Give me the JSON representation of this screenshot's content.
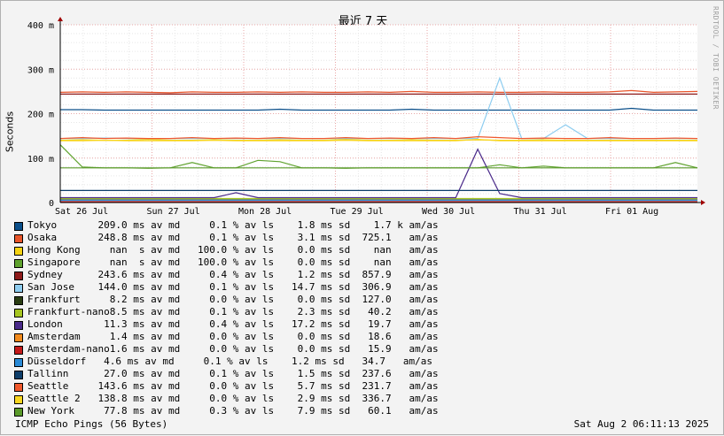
{
  "watermark": "RRDTOOL / TOBI OETIKER",
  "chart_data": {
    "type": "line",
    "title": "最近 7 天",
    "ylabel": "Seconds",
    "ylim": [
      0,
      0.4
    ],
    "y_ticks": [
      {
        "value": 0,
        "label": "0"
      },
      {
        "value": 0.1,
        "label": "100 m"
      },
      {
        "value": 0.2,
        "label": "200 m"
      },
      {
        "value": 0.3,
        "label": "300 m"
      },
      {
        "value": 0.4,
        "label": "400 m"
      }
    ],
    "x_ticks": [
      "Sat 26 Jul",
      "Sun 27 Jul",
      "Mon 28 Jul",
      "Tue 29 Jul",
      "Wed 30 Jul",
      "Thu 31 Jul",
      "Fri 01 Aug"
    ],
    "grid": true,
    "series": [
      {
        "name": "Tokyo",
        "color": "#0b4f8a",
        "values": [
          0.209,
          0.209,
          0.208,
          0.208,
          0.208,
          0.208,
          0.208,
          0.208,
          0.208,
          0.208,
          0.21,
          0.208,
          0.208,
          0.208,
          0.208,
          0.208,
          0.21,
          0.208,
          0.208,
          0.208,
          0.208,
          0.208,
          0.208,
          0.208,
          0.208,
          0.208,
          0.212,
          0.208,
          0.208,
          0.208
        ]
      },
      {
        "name": "Osaka",
        "color": "#e8552a",
        "values": [
          0.248,
          0.249,
          0.248,
          0.249,
          0.248,
          0.247,
          0.249,
          0.248,
          0.248,
          0.249,
          0.248,
          0.249,
          0.248,
          0.248,
          0.249,
          0.248,
          0.25,
          0.248,
          0.248,
          0.249,
          0.248,
          0.248,
          0.249,
          0.248,
          0.248,
          0.249,
          0.252,
          0.248,
          0.249,
          0.25
        ]
      },
      {
        "name": "Hong Kong",
        "color": "#f5d312",
        "values": [
          0.14,
          0.141,
          0.14,
          0.14,
          0.142,
          0.14,
          0.14,
          0.141,
          0.14,
          0.14,
          0.141,
          0.14,
          0.14,
          0.142,
          0.14,
          0.14,
          0.141,
          0.14,
          0.14,
          0.141,
          0.14,
          0.14,
          0.141,
          0.14,
          0.14,
          0.14,
          0.14,
          0.14,
          0.14,
          0.14
        ]
      },
      {
        "name": "Singapore",
        "color": "#5fa22e",
        "values": [
          0.13,
          0.08,
          0.078,
          0.078,
          0.077,
          0.078,
          0.09,
          0.078,
          0.078,
          0.095,
          0.092,
          0.078,
          0.078,
          0.077,
          0.078,
          0.078,
          0.078,
          0.078,
          0.078,
          0.078,
          0.085,
          0.078,
          0.082,
          0.078,
          0.078,
          0.078,
          0.078,
          0.078,
          0.09,
          0.078
        ]
      },
      {
        "name": "Sydney",
        "color": "#8e1a1a",
        "values": [
          0.244,
          0.244,
          0.244,
          0.244,
          0.244,
          0.244,
          0.244,
          0.244,
          0.244,
          0.244,
          0.244,
          0.244,
          0.244,
          0.244,
          0.244,
          0.244,
          0.244,
          0.244,
          0.244,
          0.244,
          0.244,
          0.244,
          0.244,
          0.244,
          0.244,
          0.244,
          0.244,
          0.244,
          0.244,
          0.244
        ]
      },
      {
        "name": "San Jose",
        "color": "#8ecdf0",
        "values": [
          0.144,
          0.144,
          0.145,
          0.144,
          0.144,
          0.144,
          0.144,
          0.144,
          0.144,
          0.144,
          0.144,
          0.144,
          0.144,
          0.144,
          0.144,
          0.144,
          0.144,
          0.144,
          0.144,
          0.144,
          0.28,
          0.144,
          0.144,
          0.175,
          0.144,
          0.144,
          0.144,
          0.144,
          0.144,
          0.144
        ]
      },
      {
        "name": "Frankfurt",
        "color": "#2a3d12",
        "values": [
          0.008,
          0.008,
          0.008,
          0.008,
          0.008,
          0.008,
          0.008,
          0.008,
          0.008,
          0.008,
          0.008,
          0.008,
          0.008,
          0.008,
          0.008,
          0.008,
          0.008,
          0.008,
          0.008,
          0.008,
          0.008,
          0.008,
          0.008,
          0.008,
          0.008,
          0.008,
          0.008,
          0.008,
          0.008,
          0.008
        ]
      },
      {
        "name": "Frankfurt-nano",
        "color": "#a6c520",
        "values": [
          0.009,
          0.009,
          0.009,
          0.009,
          0.009,
          0.009,
          0.009,
          0.009,
          0.009,
          0.009,
          0.009,
          0.009,
          0.009,
          0.009,
          0.009,
          0.009,
          0.009,
          0.009,
          0.009,
          0.009,
          0.009,
          0.009,
          0.009,
          0.009,
          0.009,
          0.009,
          0.009,
          0.009,
          0.009,
          0.009
        ]
      },
      {
        "name": "London",
        "color": "#4a2a8a",
        "values": [
          0.011,
          0.011,
          0.011,
          0.011,
          0.011,
          0.011,
          0.011,
          0.011,
          0.022,
          0.011,
          0.011,
          0.011,
          0.011,
          0.011,
          0.011,
          0.011,
          0.011,
          0.011,
          0.011,
          0.12,
          0.02,
          0.011,
          0.011,
          0.011,
          0.011,
          0.011,
          0.011,
          0.011,
          0.011,
          0.011
        ]
      },
      {
        "name": "Amsterdam",
        "color": "#f28a1c",
        "values": [
          0.001,
          0.001,
          0.001,
          0.001,
          0.001,
          0.001,
          0.001,
          0.001,
          0.001,
          0.001,
          0.001,
          0.001,
          0.001,
          0.001,
          0.001,
          0.001,
          0.001,
          0.001,
          0.001,
          0.001,
          0.001,
          0.001,
          0.001,
          0.001,
          0.001,
          0.001,
          0.001,
          0.001,
          0.001,
          0.001
        ]
      },
      {
        "name": "Amsterdam-nano",
        "color": "#c41a1a",
        "values": [
          0.002,
          0.002,
          0.002,
          0.002,
          0.002,
          0.002,
          0.002,
          0.002,
          0.002,
          0.002,
          0.002,
          0.002,
          0.002,
          0.002,
          0.002,
          0.002,
          0.002,
          0.002,
          0.002,
          0.002,
          0.002,
          0.002,
          0.002,
          0.002,
          0.002,
          0.002,
          0.002,
          0.002,
          0.002,
          0.002
        ]
      },
      {
        "name": "Düsseldorf",
        "color": "#2a8ad6",
        "values": [
          0.005,
          0.005,
          0.005,
          0.005,
          0.005,
          0.005,
          0.005,
          0.005,
          0.005,
          0.005,
          0.005,
          0.005,
          0.005,
          0.005,
          0.005,
          0.005,
          0.005,
          0.005,
          0.005,
          0.005,
          0.005,
          0.005,
          0.005,
          0.005,
          0.005,
          0.005,
          0.005,
          0.005,
          0.005,
          0.005
        ]
      },
      {
        "name": "Tallinn",
        "color": "#0e3e6a",
        "values": [
          0.027,
          0.027,
          0.027,
          0.027,
          0.027,
          0.027,
          0.027,
          0.027,
          0.027,
          0.027,
          0.027,
          0.027,
          0.027,
          0.027,
          0.027,
          0.027,
          0.027,
          0.027,
          0.027,
          0.027,
          0.027,
          0.027,
          0.027,
          0.027,
          0.027,
          0.027,
          0.027,
          0.027,
          0.027,
          0.027
        ]
      },
      {
        "name": "Seattle",
        "color": "#f0582c",
        "values": [
          0.144,
          0.146,
          0.144,
          0.145,
          0.144,
          0.144,
          0.146,
          0.144,
          0.145,
          0.144,
          0.146,
          0.144,
          0.144,
          0.146,
          0.144,
          0.145,
          0.144,
          0.146,
          0.144,
          0.148,
          0.146,
          0.144,
          0.145,
          0.144,
          0.144,
          0.146,
          0.144,
          0.144,
          0.145,
          0.144
        ]
      },
      {
        "name": "Seattle 2",
        "color": "#f8d620",
        "values": [
          0.139,
          0.139,
          0.14,
          0.139,
          0.139,
          0.139,
          0.139,
          0.14,
          0.139,
          0.139,
          0.139,
          0.139,
          0.139,
          0.14,
          0.139,
          0.139,
          0.139,
          0.139,
          0.139,
          0.142,
          0.139,
          0.139,
          0.139,
          0.139,
          0.139,
          0.139,
          0.139,
          0.139,
          0.139,
          0.139
        ]
      },
      {
        "name": "New York",
        "color": "#5a9a2a",
        "values": [
          0.078,
          0.078,
          0.078,
          0.078,
          0.078,
          0.078,
          0.078,
          0.078,
          0.078,
          0.078,
          0.078,
          0.078,
          0.078,
          0.078,
          0.078,
          0.078,
          0.078,
          0.078,
          0.078,
          0.078,
          0.078,
          0.078,
          0.078,
          0.078,
          0.078,
          0.078,
          0.078,
          0.078,
          0.078,
          0.078
        ]
      }
    ]
  },
  "legend": [
    {
      "name": "Tokyo",
      "color": "#0b4f8a",
      "stats": "            209.0 ms av md     0.1 % av ls    1.8 ms sd    1.7 k am/as"
    },
    {
      "name": "Osaka",
      "color": "#e8552a",
      "stats": "            248.8 ms av md     0.1 % av ls    3.1 ms sd  725.1   am/as"
    },
    {
      "name": "Hong Kong",
      "color": "#f5d312",
      "stats": "              nan  s av md   100.0 % av ls    0.0 ms sd    nan   am/as"
    },
    {
      "name": "Singapore",
      "color": "#5fa22e",
      "stats": "              nan  s av md   100.0 % av ls    0.0 ms sd    nan   am/as"
    },
    {
      "name": "Sydney",
      "color": "#8e1a1a",
      "stats": "            243.6 ms av md     0.4 % av ls    1.2 ms sd  857.9   am/as"
    },
    {
      "name": "San Jose",
      "color": "#8ecdf0",
      "stats": "            144.0 ms av md     0.1 % av ls   14.7 ms sd  306.9   am/as"
    },
    {
      "name": "Frankfurt",
      "color": "#2a3d12",
      "stats": "              8.2 ms av md     0.0 % av ls    0.0 ms sd  127.0   am/as"
    },
    {
      "name": "Frankfurt-nano",
      "color": "#a6c520",
      "stats": "              8.5 ms av md     0.1 % av ls    2.3 ms sd   40.2   am/as"
    },
    {
      "name": "London",
      "color": "#4a2a8a",
      "stats": "             11.3 ms av md     0.4 % av ls   17.2 ms sd   19.7   am/as"
    },
    {
      "name": "Amsterdam",
      "color": "#f28a1c",
      "stats": "              1.4 ms av md     0.0 % av ls    0.0 ms sd   18.6   am/as"
    },
    {
      "name": "Amsterdam-nano",
      "color": "#c41a1a",
      "stats": "              1.6 ms av md     0.0 % av ls    0.0 ms sd   15.9   am/as"
    },
    {
      "name": "Düsseldorf",
      "color": "#2a8ad6",
      "stats": "             4.6 ms av md     0.1 % av ls    1.2 ms sd   34.7   am/as"
    },
    {
      "name": "Tallinn",
      "color": "#0e3e6a",
      "stats": "             27.0 ms av md     0.1 % av ls    1.5 ms sd  237.6   am/as"
    },
    {
      "name": "Seattle",
      "color": "#f0582c",
      "stats": "            143.6 ms av md     0.0 % av ls    5.7 ms sd  231.7   am/as"
    },
    {
      "name": "Seattle 2",
      "color": "#f8d620",
      "stats": "            138.8 ms av md     0.0 % av ls    2.9 ms sd  336.7   am/as"
    },
    {
      "name": "New York",
      "color": "#5a9a2a",
      "stats": "             77.8 ms av md     0.3 % av ls    7.9 ms sd   60.1   am/as"
    }
  ],
  "footer": {
    "left": "ICMP Echo Pings (56 Bytes)",
    "right": "Sat Aug  2 06:11:13 2025"
  }
}
